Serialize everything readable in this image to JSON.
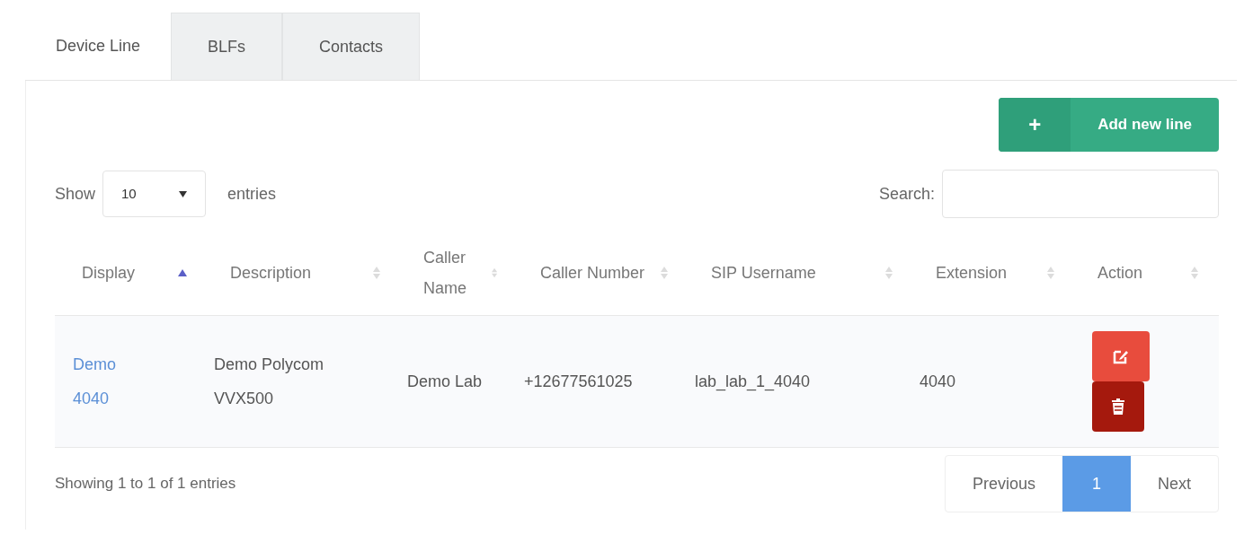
{
  "tabs": [
    {
      "label": "Device Line",
      "selected": true
    },
    {
      "label": "BLFs",
      "selected": false
    },
    {
      "label": "Contacts",
      "selected": false
    }
  ],
  "add_button": {
    "icon": "+",
    "label": "Add new line"
  },
  "length_menu": {
    "before": "Show",
    "value": "10",
    "after": "entries"
  },
  "search": {
    "label": "Search:"
  },
  "table": {
    "columns": [
      {
        "label": "Display",
        "sorted": true
      },
      {
        "label": "Description",
        "sorted": false
      },
      {
        "label": "Caller Name",
        "sorted": false
      },
      {
        "label": "Caller Number",
        "sorted": false
      },
      {
        "label": "SIP Username",
        "sorted": false
      },
      {
        "label": "Extension",
        "sorted": false
      },
      {
        "label": "Action",
        "sorted": false
      }
    ],
    "rows": [
      {
        "display": "Demo 4040",
        "description": "Demo Polycom VVX500",
        "caller_name": "Demo Lab",
        "caller_number": "+12677561025",
        "sip_username": "lab_lab_1_4040",
        "extension": "4040"
      }
    ]
  },
  "info": "Showing 1 to 1 of 1 entries",
  "pagination": {
    "previous": "Previous",
    "pages": [
      {
        "label": "1",
        "selected": true
      }
    ],
    "next": "Next"
  }
}
